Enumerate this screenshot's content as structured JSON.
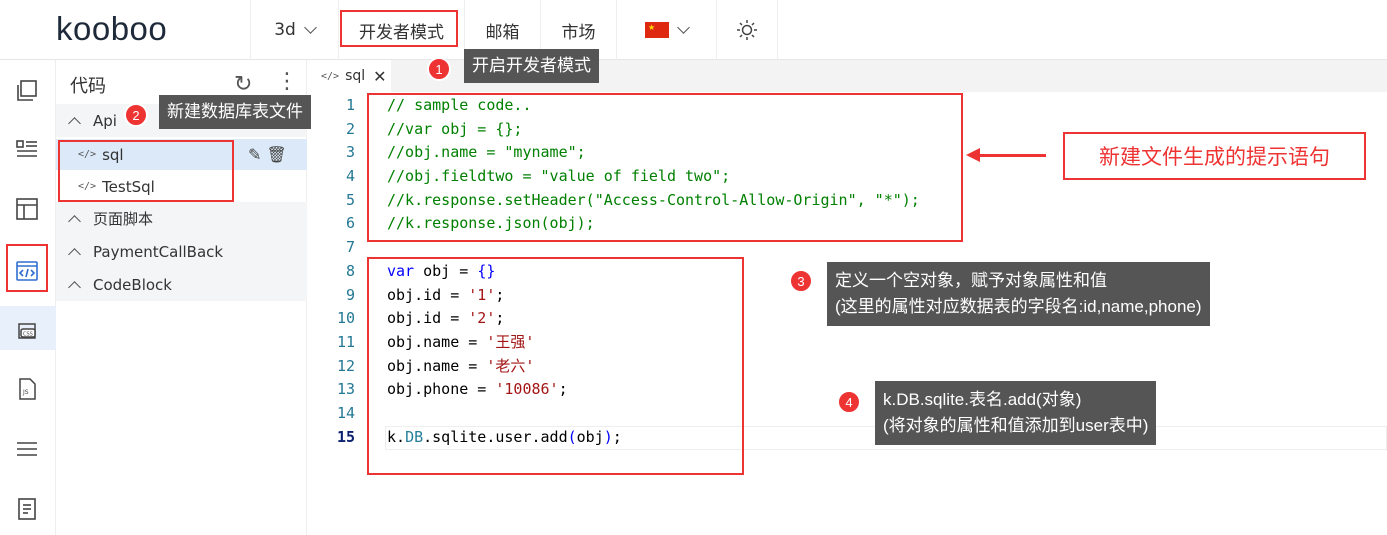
{
  "brand": {
    "logo_text": "kooboo"
  },
  "nav": {
    "site": "3d",
    "dev_mode": "开发者模式",
    "mail": "邮箱",
    "market": "市场"
  },
  "panel": {
    "title": "代码",
    "groups": [
      {
        "label": "Api",
        "files": [
          "sql",
          "TestSql"
        ]
      },
      {
        "label": "页面脚本"
      },
      {
        "label": "PaymentCallBack"
      },
      {
        "label": "CodeBlock"
      }
    ],
    "file_icon": "</>"
  },
  "editor": {
    "tab_label": "sql",
    "line_numbers": [
      "1",
      "2",
      "3",
      "4",
      "5",
      "6",
      "7",
      "8",
      "9",
      "10",
      "11",
      "12",
      "13",
      "14",
      "15"
    ],
    "lines": [
      "// sample code..",
      "//var obj = {};",
      "//obj.name = \"myname\";",
      "//obj.fieldtwo = \"value of field two\";",
      "//k.response.setHeader(\"Access-Control-Allow-Origin\", \"*\");",
      "//k.response.json(obj);",
      "",
      "var obj = {}",
      "obj.id = '1';",
      "obj.id = '2';",
      "obj.name = '王强'",
      "obj.name = '老六'",
      "obj.phone = '10086';",
      "",
      "k.DB.sqlite.user.add(obj);"
    ]
  },
  "annotations": {
    "hint": "新建文件生成的提示语句",
    "tip1": {
      "num": "1",
      "text": "开启开发者模式"
    },
    "tip2": {
      "num": "2",
      "text": "新建数据库表文件"
    },
    "tip3": {
      "num": "3",
      "line1": "定义一个空对象，赋予对象属性和值",
      "line2": "(这里的属性对应数据表的字段名:id,name,phone)"
    },
    "tip4": {
      "num": "4",
      "line1": "k.DB.sqlite.表名.add(对象)",
      "line2": "(将对象的属性和值添加到user表中)"
    }
  },
  "colors": {
    "accent_red": "#ee3333",
    "comment": "#008000",
    "keyword": "#0000ff",
    "string": "#a31515"
  }
}
